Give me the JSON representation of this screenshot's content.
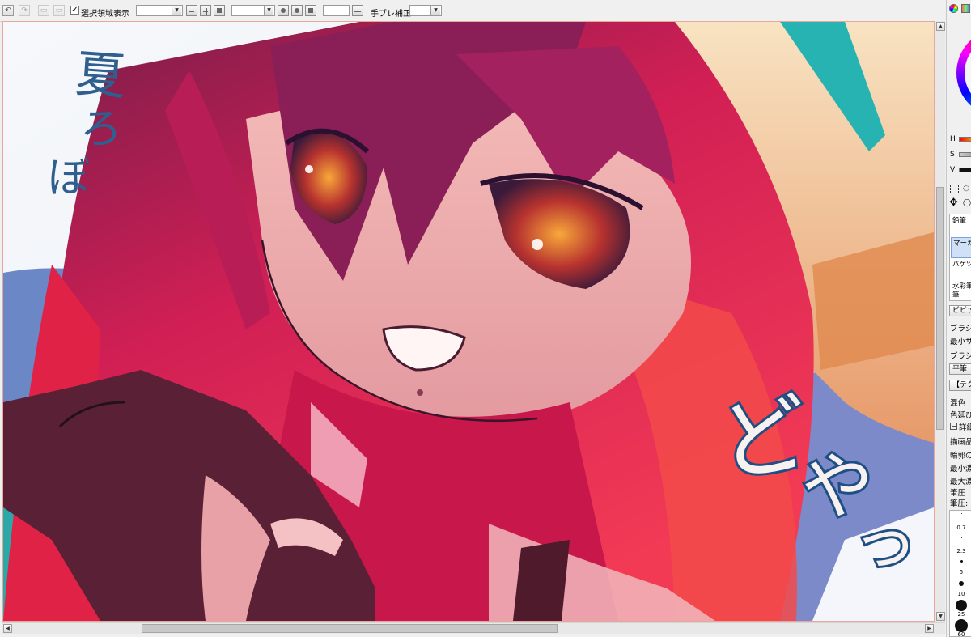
{
  "toolbar": {
    "selection_checkbox_checked": true,
    "selection_label": "選択領域表示",
    "zoom_value": "",
    "rotate_value": "",
    "stabilizer_value": "",
    "stabilizer_label": "手ブレ補正",
    "stabilizer_combo_value": ""
  },
  "canvas": {
    "handwritten_left": "夏ろぼ",
    "handwritten_right": "どやっ"
  },
  "panel": {
    "hsv": [
      "H",
      "S",
      "V"
    ],
    "tools": [
      {
        "label": "鉛筆"
      },
      {
        "label": "マーカー",
        "active": true
      },
      {
        "label": "バケツ"
      },
      {
        "label": "水彩筆"
      },
      {
        "label": "筆"
      }
    ],
    "preset_button": "ビビッド",
    "settings": {
      "brush_size": "ブラシサ",
      "min_size": "最小サ",
      "brush_density": "ブラシ濃",
      "shape_button": "平筆",
      "texture_button": "【テクス",
      "blend": "混色",
      "color_stretch": "色延び",
      "detail_toggle": "詳細",
      "quality": "描画品",
      "edge_hardness": "輪郭の",
      "min_density": "最小濃",
      "max_density": "最大濃",
      "pen_pressure": "筆圧",
      "pen_pressure_extra": "筆圧:"
    },
    "sizes": [
      {
        "label": "",
        "dot": 1
      },
      {
        "label": "0.7",
        "dot": 0
      },
      {
        "label": "",
        "dot": 1
      },
      {
        "label": "2.3",
        "dot": 0
      },
      {
        "label": "",
        "dot": 3
      },
      {
        "label": "5",
        "dot": 0
      },
      {
        "label": "",
        "dot": 6
      },
      {
        "label": "10",
        "dot": 0
      },
      {
        "label": "",
        "dot": 14
      },
      {
        "label": "25",
        "dot": 0
      },
      {
        "label": "",
        "dot": 18
      },
      {
        "label": "60",
        "dot": 0
      }
    ]
  }
}
